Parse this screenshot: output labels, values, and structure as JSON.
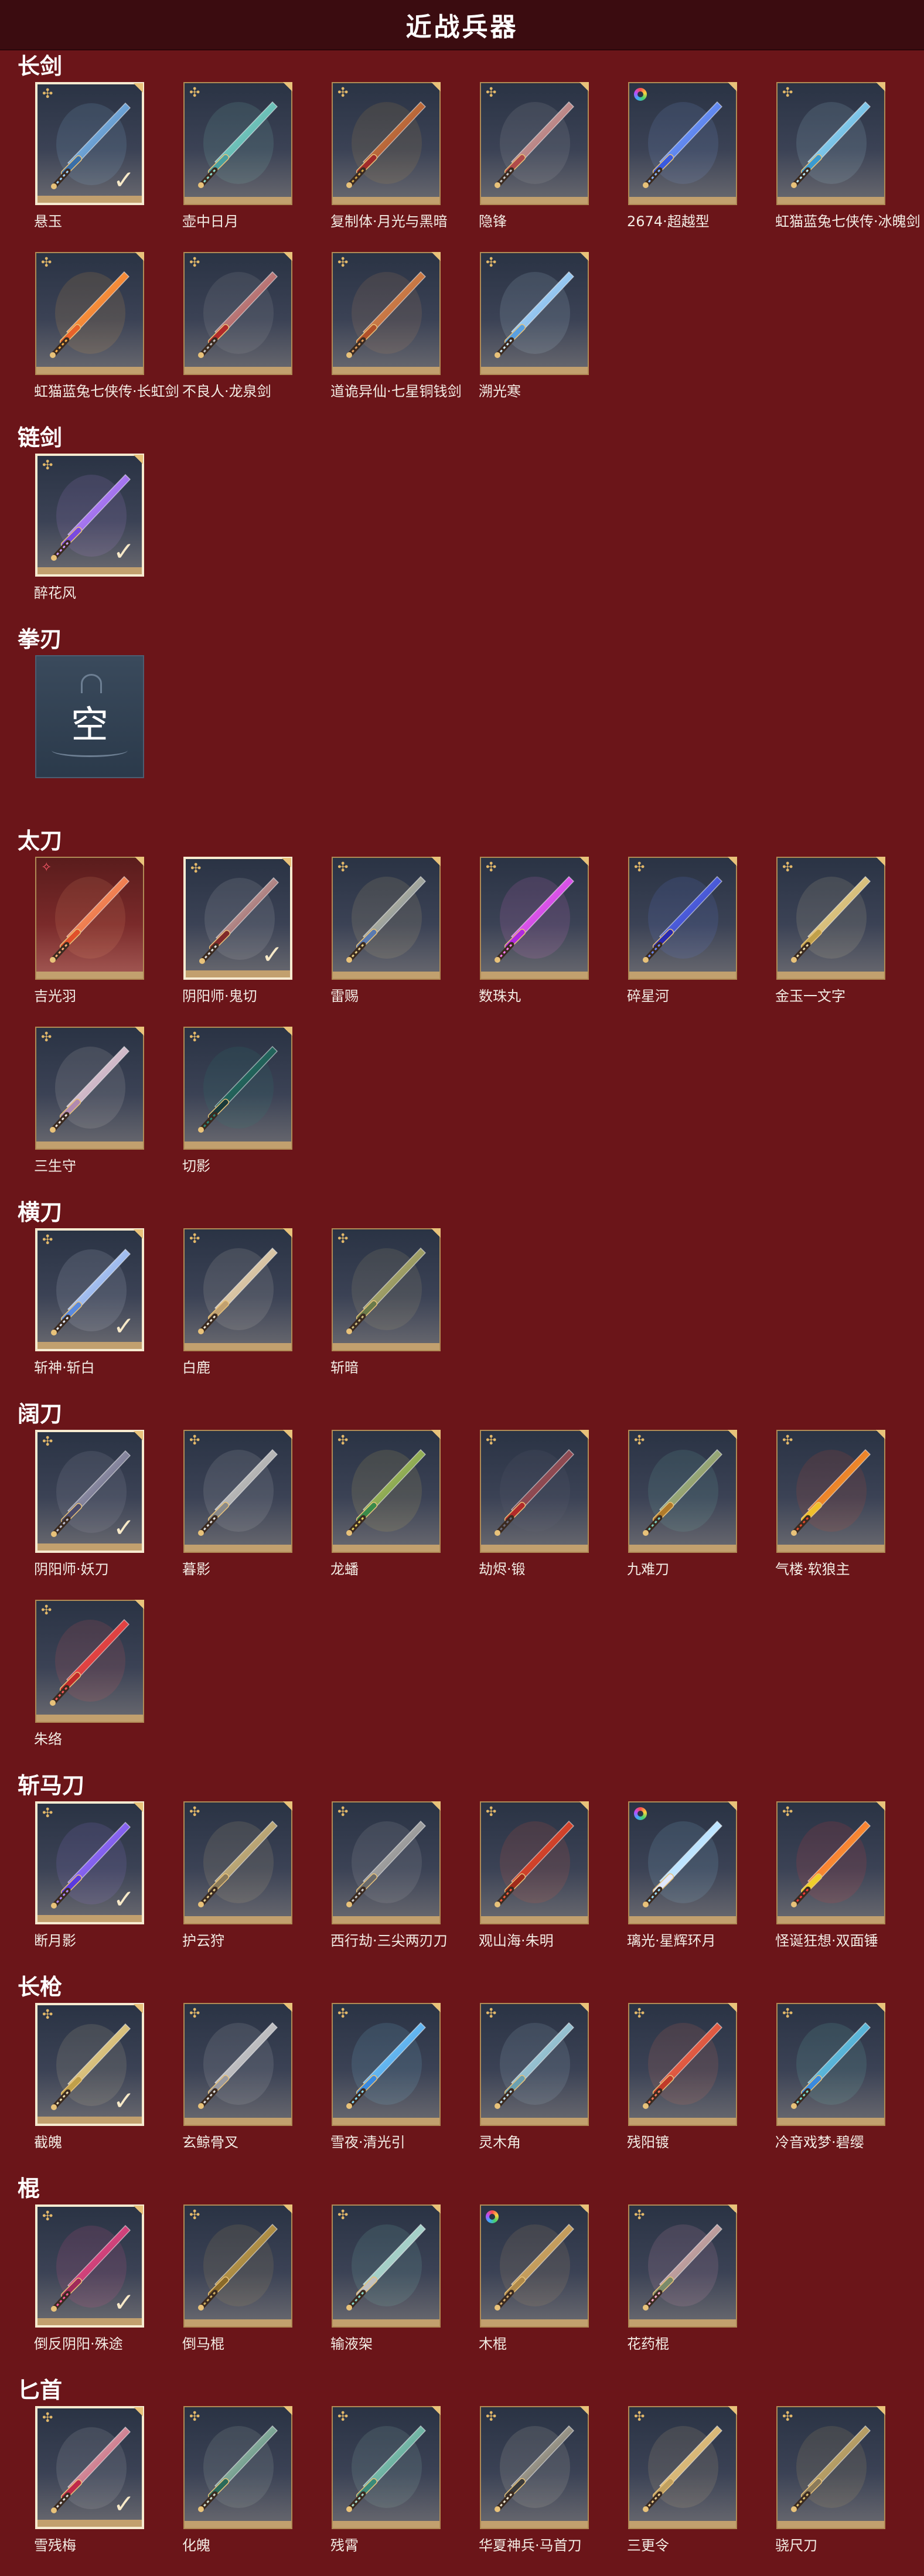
{
  "header": {
    "title": "近战兵器"
  },
  "colors": {
    "background": "#6b1519",
    "header_bg": "#3b0c10",
    "card_border": "#b08a55",
    "equipped_border": "#f6ead0"
  },
  "sections": [
    {
      "title": "长剑",
      "items": [
        {
          "name": "悬玉",
          "tag": "quality-icon",
          "equipped": true,
          "colors": [
            "#9fd4ff",
            "#3a6fa8"
          ]
        },
        {
          "name": "壶中日月",
          "tag": "quality-icon",
          "equipped": false,
          "colors": [
            "#8fe0d0",
            "#4aa0a0"
          ]
        },
        {
          "name": "复制体·月光与黑暗",
          "tag": "quality-icon",
          "equipped": false,
          "colors": [
            "#d4a74a",
            "#a02a2a"
          ]
        },
        {
          "name": "隐锋",
          "tag": "quality-icon",
          "equipped": false,
          "colors": [
            "#c8c8c8",
            "#b04a4a"
          ]
        },
        {
          "name": "2674·超越型",
          "tag": "rainbow-icon",
          "equipped": false,
          "colors": [
            "#8ab8ff",
            "#3a5adf"
          ]
        },
        {
          "name": "虹猫蓝兔七侠传·冰魄剑",
          "tag": "quality-icon",
          "equipped": false,
          "colors": [
            "#bfefff",
            "#3a9ad0"
          ]
        },
        {
          "name": "虹猫蓝兔七侠传·长虹剑",
          "tag": "quality-icon",
          "equipped": false,
          "colors": [
            "#ffb347",
            "#e8622a"
          ]
        },
        {
          "name": "不良人·龙泉剑",
          "tag": "quality-icon",
          "equipped": false,
          "colors": [
            "#c0c0c0",
            "#b02a2a"
          ]
        },
        {
          "name": "道诡异仙·七星铜钱剑",
          "tag": "quality-icon",
          "equipped": false,
          "colors": [
            "#e0a060",
            "#b0502a"
          ]
        },
        {
          "name": "溯光寒",
          "tag": "quality-icon",
          "equipped": false,
          "colors": [
            "#d0ecff",
            "#5aa0e0"
          ]
        }
      ]
    },
    {
      "title": "链剑",
      "items": [
        {
          "name": "醉花风",
          "tag": "quality-icon",
          "equipped": true,
          "colors": [
            "#d0a0ff",
            "#7a4adf"
          ]
        }
      ]
    },
    {
      "title": "拳刃",
      "empty": true,
      "empty_label": "空"
    },
    {
      "title": "太刀",
      "items": [
        {
          "name": "吉光羽",
          "tag": "star-icon",
          "equipped": false,
          "colors": [
            "#ffb07a",
            "#e0502a"
          ],
          "red": true
        },
        {
          "name": "阴阳师·鬼切",
          "tag": "quality-icon",
          "equipped": true,
          "colors": [
            "#e0e0e0",
            "#802a2a"
          ]
        },
        {
          "name": "雷赐",
          "tag": "quality-icon",
          "equipped": false,
          "colors": [
            "#e8d08a",
            "#5a7ab0"
          ]
        },
        {
          "name": "数珠丸",
          "tag": "quality-icon",
          "equipped": false,
          "colors": [
            "#ff7af0",
            "#b02adf"
          ]
        },
        {
          "name": "碎星河",
          "tag": "quality-icon",
          "equipped": false,
          "colors": [
            "#6a8aff",
            "#2a2ab0"
          ]
        },
        {
          "name": "金玉一文字",
          "tag": "quality-icon",
          "equipped": false,
          "colors": [
            "#f0e0b0",
            "#c0a04a"
          ]
        },
        {
          "name": "三生守",
          "tag": "quality-icon",
          "equipped": false,
          "colors": [
            "#f0e8e0",
            "#b08ab0"
          ]
        },
        {
          "name": "切影",
          "tag": "quality-icon",
          "equipped": false,
          "colors": [
            "#2a8a7a",
            "#1a3a3a"
          ]
        }
      ]
    },
    {
      "title": "横刀",
      "items": [
        {
          "name": "斩神·斩白",
          "tag": "quality-icon",
          "equipped": true,
          "colors": [
            "#e8f0ff",
            "#5a8adf"
          ]
        },
        {
          "name": "白鹿",
          "tag": "quality-icon",
          "equipped": false,
          "colors": [
            "#f0e8d8",
            "#c0a070"
          ]
        },
        {
          "name": "斩暗",
          "tag": "quality-icon",
          "equipped": false,
          "colors": [
            "#d0c080",
            "#6a7a4a"
          ]
        }
      ]
    },
    {
      "title": "阔刀",
      "items": [
        {
          "name": "阴阳师·妖刀",
          "tag": "quality-icon",
          "equipped": true,
          "colors": [
            "#c0c0d0",
            "#4a4a6a"
          ]
        },
        {
          "name": "暮影",
          "tag": "quality-icon",
          "equipped": false,
          "colors": [
            "#e0e0e0",
            "#8a8a8a"
          ]
        },
        {
          "name": "龙蟠",
          "tag": "quality-icon",
          "equipped": false,
          "colors": [
            "#e8d060",
            "#3a8a4a"
          ]
        },
        {
          "name": "劫烬·锻",
          "tag": "quality-icon",
          "equipped": false,
          "colors": [
            "#6a6a7a",
            "#b02a2a"
          ]
        },
        {
          "name": "九难刀",
          "tag": "quality-icon",
          "equipped": false,
          "colors": [
            "#7ad0c0",
            "#b07a2a"
          ]
        },
        {
          "name": "气楼·软狼主",
          "tag": "quality-icon",
          "equipped": false,
          "colors": [
            "#e84a2a",
            "#f0c02a"
          ]
        },
        {
          "name": "朱络",
          "tag": "quality-icon",
          "equipped": false,
          "colors": [
            "#ff5a5a",
            "#c02a2a"
          ]
        }
      ]
    },
    {
      "title": "斩马刀",
      "items": [
        {
          "name": "断月影",
          "tag": "quality-icon",
          "equipped": true,
          "colors": [
            "#b08aff",
            "#5a3adf"
          ]
        },
        {
          "name": "护云狩",
          "tag": "quality-icon",
          "equipped": false,
          "colors": [
            "#e8d090",
            "#8a7a5a"
          ]
        },
        {
          "name": "西行劫·三尖两刃刀",
          "tag": "quality-icon",
          "equipped": false,
          "colors": [
            "#d0d0d0",
            "#6a6a6a"
          ]
        },
        {
          "name": "观山海·朱明",
          "tag": "quality-icon",
          "equipped": false,
          "colors": [
            "#ff5a3a",
            "#a02a1a"
          ]
        },
        {
          "name": "璃光·星辉环月",
          "tag": "rainbow-icon",
          "equipped": false,
          "colors": [
            "#9adfff",
            "#e0e8ff"
          ]
        },
        {
          "name": "怪诞狂想·双面锤",
          "tag": "quality-icon",
          "equipped": false,
          "colors": [
            "#ff3a3a",
            "#f0d02a"
          ]
        }
      ]
    },
    {
      "title": "长枪",
      "items": [
        {
          "name": "截魄",
          "tag": "quality-icon",
          "equipped": true,
          "colors": [
            "#f0e0b0",
            "#c0a04a"
          ]
        },
        {
          "name": "玄鲸骨叉",
          "tag": "quality-icon",
          "equipped": false,
          "colors": [
            "#e0e0e0",
            "#9a9aa0"
          ]
        },
        {
          "name": "雪夜·清光引",
          "tag": "quality-icon",
          "equipped": false,
          "colors": [
            "#8adfff",
            "#3a8adf"
          ]
        },
        {
          "name": "灵木角",
          "tag": "quality-icon",
          "equipped": false,
          "colors": [
            "#c0e0f0",
            "#6aa0b0"
          ]
        },
        {
          "name": "残阳镀",
          "tag": "quality-icon",
          "equipped": false,
          "colors": [
            "#ff7a5a",
            "#c03a2a"
          ]
        },
        {
          "name": "冷音戏梦·碧缨",
          "tag": "quality-icon",
          "equipped": false,
          "colors": [
            "#7ae0d0",
            "#3a8adf"
          ]
        }
      ]
    },
    {
      "title": "棍",
      "items": [
        {
          "name": "倒反阴阳·殊途",
          "tag": "quality-icon",
          "equipped": true,
          "colors": [
            "#ff5a9a",
            "#a02a5a"
          ]
        },
        {
          "name": "倒马棍",
          "tag": "quality-icon",
          "equipped": false,
          "colors": [
            "#d0b060",
            "#8a6a2a"
          ]
        },
        {
          "name": "输液架",
          "tag": "quality-icon",
          "equipped": false,
          "colors": [
            "#8adfd0",
            "#c0c0c0"
          ]
        },
        {
          "name": "木棍",
          "tag": "rainbow-icon",
          "equipped": false,
          "colors": [
            "#d8b070",
            "#b08a4a"
          ]
        },
        {
          "name": "花药棍",
          "tag": "quality-icon",
          "equipped": false,
          "colors": [
            "#ffb0d0",
            "#7a8a6a"
          ]
        }
      ]
    },
    {
      "title": "匕首",
      "items": [
        {
          "name": "雪残梅",
          "tag": "quality-icon",
          "equipped": true,
          "colors": [
            "#e0e0e0",
            "#c02a4a"
          ]
        },
        {
          "name": "化魄",
          "tag": "quality-icon",
          "equipped": false,
          "colors": [
            "#d0e0d0",
            "#2a6a5a"
          ]
        },
        {
          "name": "残霄",
          "tag": "quality-icon",
          "equipped": false,
          "colors": [
            "#aae0d0",
            "#3a8a7a"
          ]
        },
        {
          "name": "华夏神兵·马首刀",
          "tag": "quality-icon",
          "equipped": false,
          "colors": [
            "#f0e8d0",
            "#3a3a3a"
          ]
        },
        {
          "name": "三更令",
          "tag": "quality-icon",
          "equipped": false,
          "colors": [
            "#f0d090",
            "#c0a060"
          ]
        },
        {
          "name": "骁尺刀",
          "tag": "quality-icon",
          "equipped": false,
          "colors": [
            "#e0c070",
            "#8a7a5a"
          ]
        }
      ]
    }
  ]
}
